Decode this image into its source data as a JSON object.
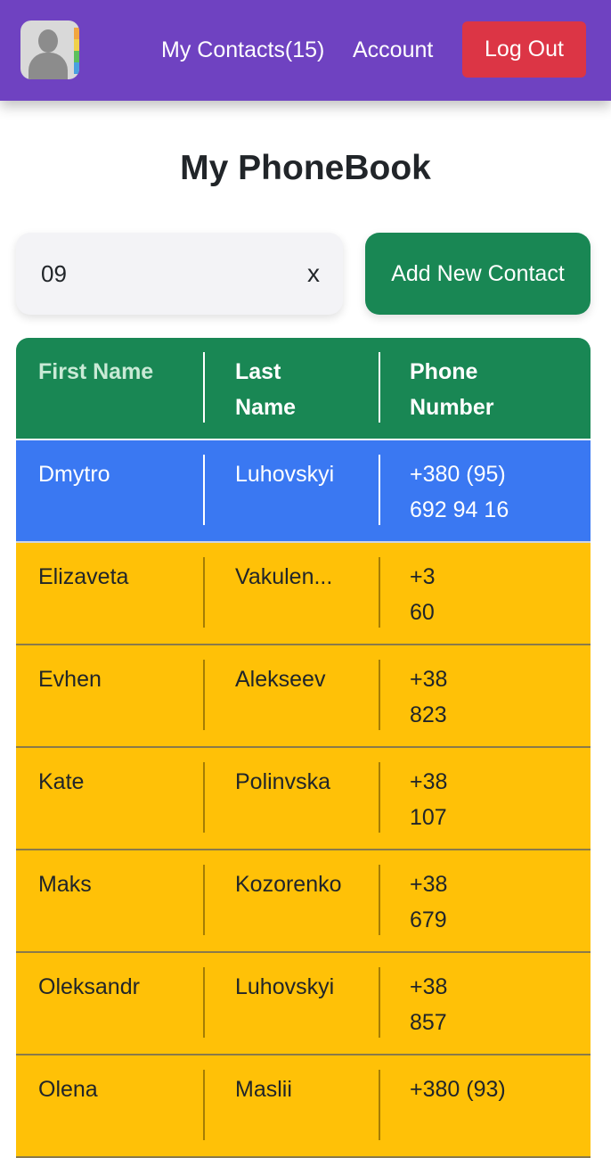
{
  "header": {
    "nav_contacts": "My Contacts(15)",
    "nav_account": "Account",
    "logout_label": "Log Out"
  },
  "page_title": "My PhoneBook",
  "search": {
    "value": "09",
    "clear_label": "x"
  },
  "add_button_label": "Add New Contact",
  "table": {
    "columns": [
      "First Name",
      "Last Name",
      "Phone Number"
    ],
    "rows": [
      {
        "first": "Dmytro",
        "last": "Luhovskyi",
        "phone": "+380 (95) 692 94 16"
      },
      {
        "first": "Elizaveta",
        "last": "Vakulen...",
        "phone": "+3 60"
      },
      {
        "first": "Evhen",
        "last": "Alekseev",
        "phone": "+38 823"
      },
      {
        "first": "Kate",
        "last": "Polinvska",
        "phone": "+38 107"
      },
      {
        "first": "Maks",
        "last": "Kozorenko",
        "phone": "+38 679"
      },
      {
        "first": "Oleksandr",
        "last": "Luhovskyi",
        "phone": "+38 857"
      },
      {
        "first": "Olena",
        "last": "Maslii",
        "phone": "+380 (93)"
      }
    ]
  },
  "colors": {
    "navbar": "#6f42c1",
    "logout": "#dc3545",
    "add_button": "#198754",
    "table_header": "#198754",
    "selected_row": "#3a78f2",
    "row": "#ffc107"
  },
  "icons": {
    "logo": "contacts-app-icon"
  }
}
